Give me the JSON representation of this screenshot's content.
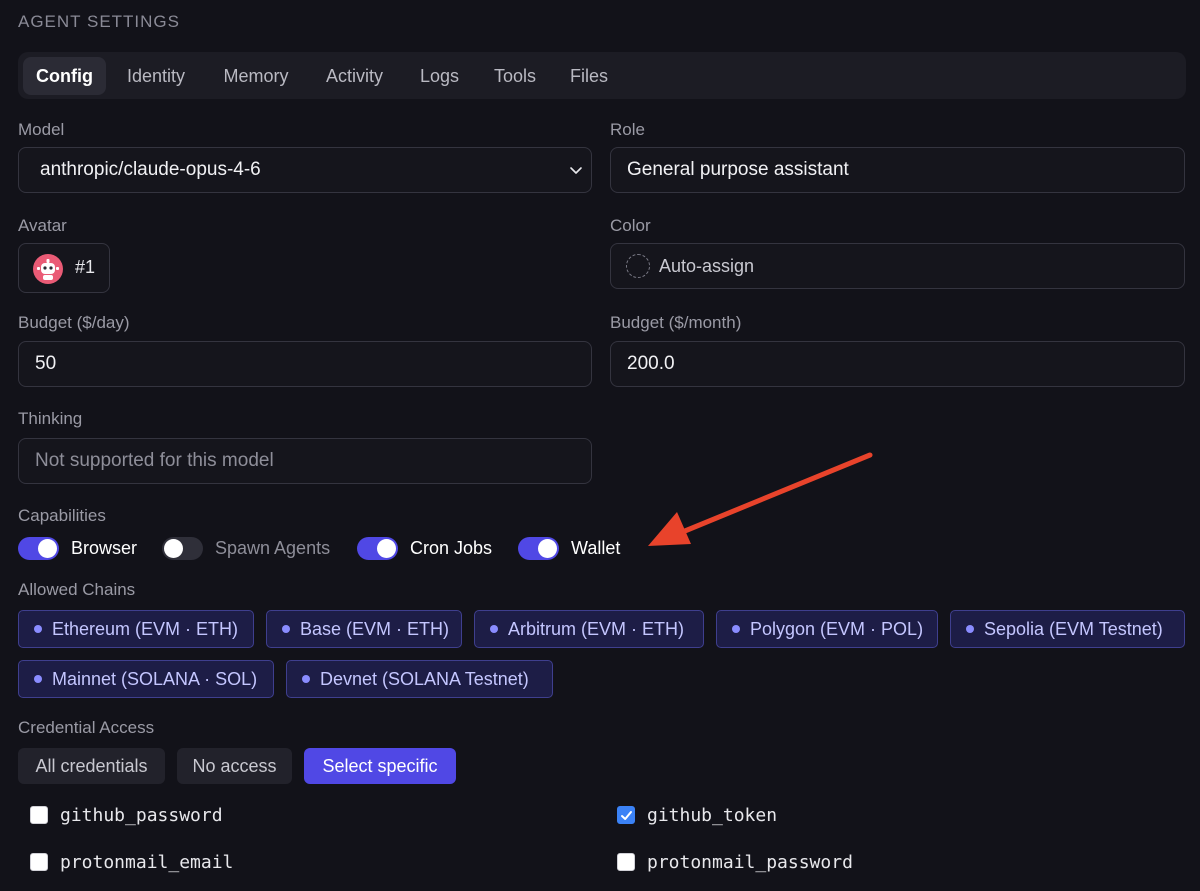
{
  "header": {
    "title": "AGENT SETTINGS"
  },
  "tabs": [
    {
      "label": "Config",
      "active": true
    },
    {
      "label": "Identity"
    },
    {
      "label": "Memory"
    },
    {
      "label": "Activity"
    },
    {
      "label": "Logs"
    },
    {
      "label": "Tools"
    },
    {
      "label": "Files"
    }
  ],
  "model": {
    "label": "Model",
    "value": "anthropic/claude-opus-4-6"
  },
  "role": {
    "label": "Role",
    "value": "General purpose assistant"
  },
  "avatar": {
    "label": "Avatar",
    "value": "#1",
    "icon": "robot-avatar-icon"
  },
  "color": {
    "label": "Color",
    "value": "Auto-assign"
  },
  "budget_day": {
    "label": "Budget ($/day)",
    "value": "50"
  },
  "budget_month": {
    "label": "Budget ($/month)",
    "value": "200.0"
  },
  "thinking": {
    "label": "Thinking",
    "placeholder": "Not supported for this model"
  },
  "capabilities": {
    "label": "Capabilities",
    "items": [
      {
        "label": "Browser",
        "enabled": true
      },
      {
        "label": "Spawn Agents",
        "enabled": false
      },
      {
        "label": "Cron Jobs",
        "enabled": true
      },
      {
        "label": "Wallet",
        "enabled": true
      }
    ]
  },
  "chains": {
    "label": "Allowed Chains",
    "items": [
      "Ethereum (EVM · ETH)",
      "Base (EVM · ETH)",
      "Arbitrum (EVM · ETH)",
      "Polygon (EVM · POL)",
      "Sepolia (EVM Testnet)",
      "Mainnet (SOLANA · SOL)",
      "Devnet (SOLANA Testnet)"
    ]
  },
  "credentials": {
    "label": "Credential Access",
    "options": [
      "All credentials",
      "No access",
      "Select specific"
    ],
    "selected_option": "Select specific",
    "items": [
      {
        "name": "github_password",
        "checked": false
      },
      {
        "name": "github_token",
        "checked": true
      },
      {
        "name": "protonmail_email",
        "checked": false
      },
      {
        "name": "protonmail_password",
        "checked": false
      }
    ]
  },
  "colors": {
    "accent": "#5048e5",
    "chip_bg": "#1d1d46",
    "arrow": "#e8432b",
    "checkbox_checked": "#3b82f6"
  }
}
